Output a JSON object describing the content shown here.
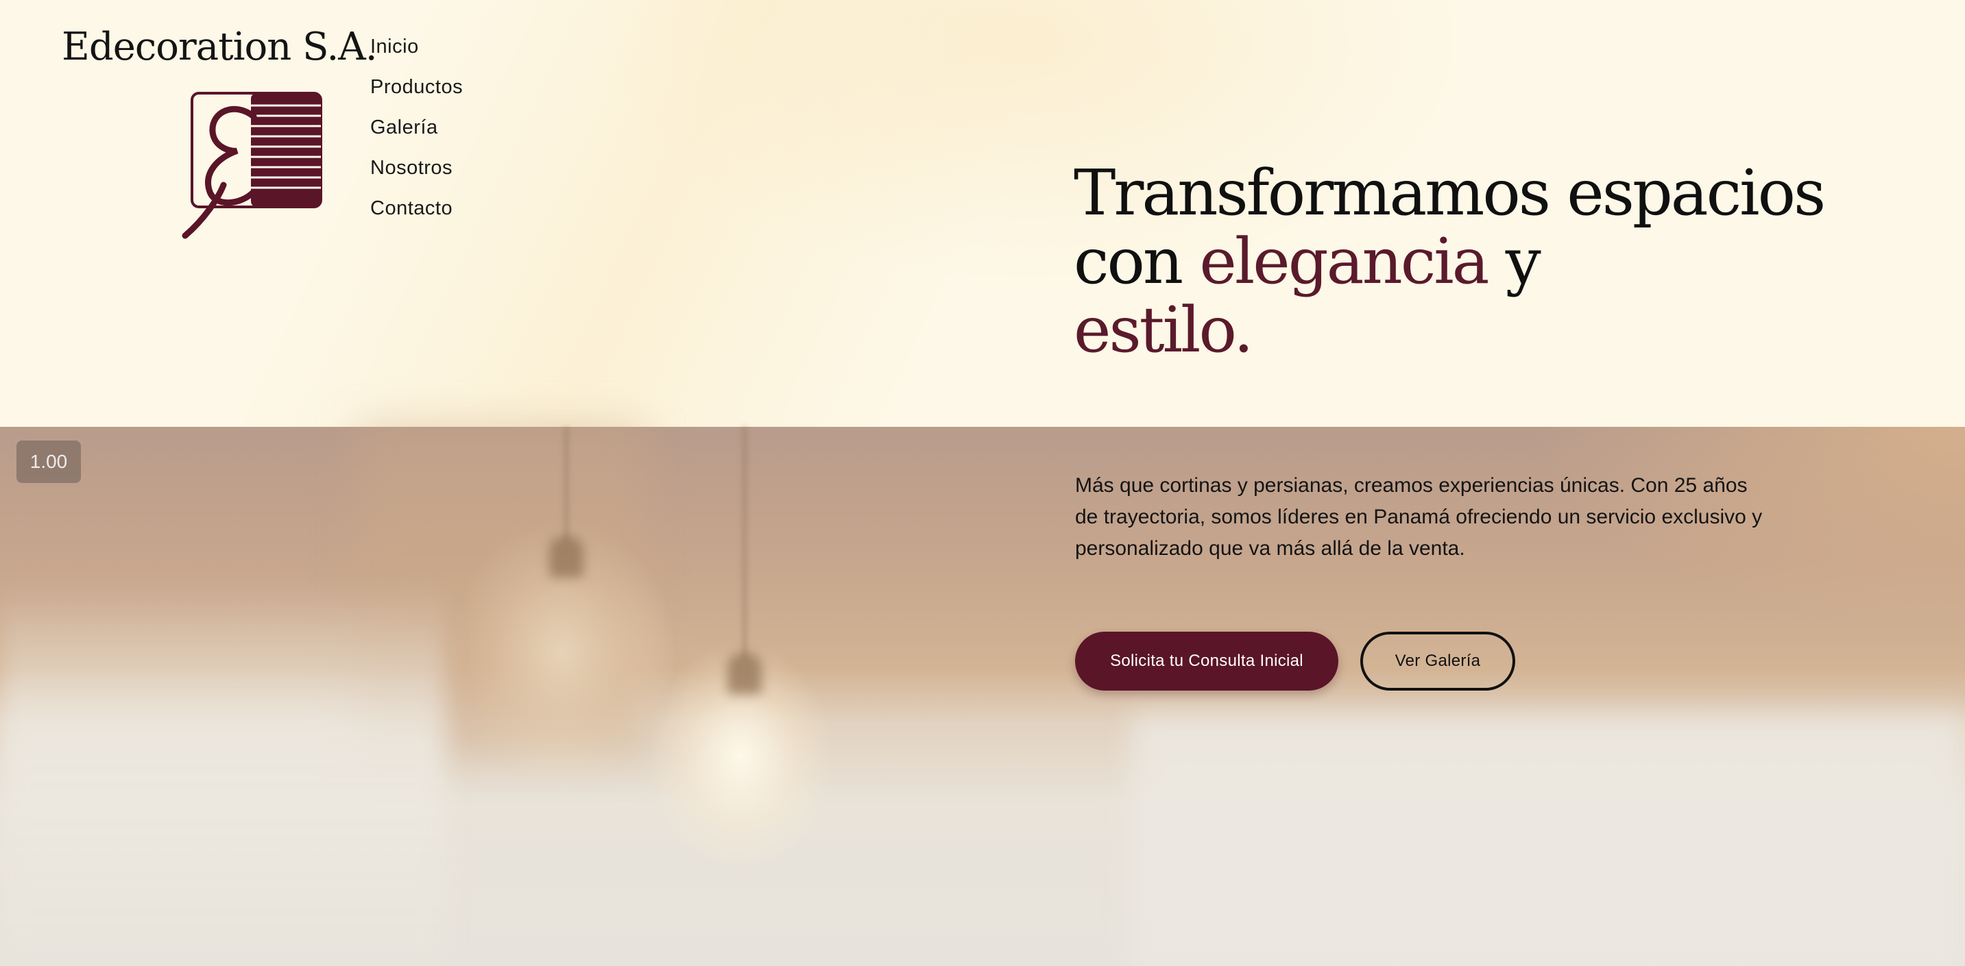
{
  "brand": {
    "name": "Edecoration S.A.",
    "logo_letter": "E",
    "logo_icon": "striped-blind-e-logo-icon"
  },
  "nav": {
    "items": [
      {
        "label": "Inicio"
      },
      {
        "label": "Productos"
      },
      {
        "label": "Galería"
      },
      {
        "label": "Nosotros"
      },
      {
        "label": "Contacto"
      }
    ]
  },
  "hero": {
    "title_part1": "Transformamos espacios con ",
    "title_accent1": "elegancia",
    "title_part2": " y ",
    "title_accent2": "estilo.",
    "description": "Más que cortinas y persianas, creamos experiencias únicas. Con 25 años de trayectoria, somos líderes en Panamá ofreciendo un servicio exclusivo y personalizado que va más allá de la venta.",
    "primary_button": "Solicita tu Consulta Inicial",
    "secondary_button": "Ver Galería"
  },
  "zoom": {
    "value": "1.00"
  },
  "colors": {
    "accent": "#5a1528",
    "background_cream": "#fdf8e7",
    "text": "#111111"
  }
}
